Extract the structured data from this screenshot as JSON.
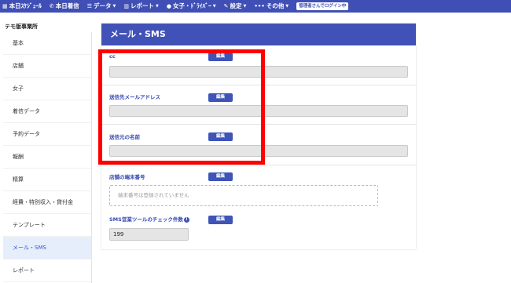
{
  "topnav": {
    "items": [
      {
        "icon": "calendar-icon",
        "glyph": "▦",
        "label": "本日ｽｹｼﾞｭｰﾙ",
        "caret": false
      },
      {
        "icon": "phone-icon",
        "glyph": "✆",
        "label": "本日着信",
        "caret": false
      },
      {
        "icon": "database-icon",
        "glyph": "☰",
        "label": "データ",
        "caret": true
      },
      {
        "icon": "chart-icon",
        "glyph": "▥",
        "label": "レポート",
        "caret": true
      },
      {
        "icon": "user-icon",
        "glyph": "●",
        "label": "女子・ﾄﾞﾗｲﾊﾞｰ",
        "caret": true
      },
      {
        "icon": "wrench-icon",
        "glyph": "✎",
        "label": "設定",
        "caret": true
      },
      {
        "icon": "ellipsis-icon",
        "glyph": "•••",
        "label": "その他",
        "caret": true
      }
    ],
    "login_badge": "管理者さんでログイン中"
  },
  "sidebar": {
    "title": "テモ版事業所",
    "items": [
      {
        "label": "基本",
        "active": false
      },
      {
        "label": "店舗",
        "active": false
      },
      {
        "label": "女子",
        "active": false
      },
      {
        "label": "着信データ",
        "active": false
      },
      {
        "label": "予約データ",
        "active": false
      },
      {
        "label": "報酬",
        "active": false
      },
      {
        "label": "精算",
        "active": false
      },
      {
        "label": "経費・特別収入・貸付金",
        "active": false
      },
      {
        "label": "テンプレート",
        "active": false
      },
      {
        "label": "メール・SMS",
        "active": true
      },
      {
        "label": "レポート",
        "active": false
      }
    ]
  },
  "panel": {
    "title": "メール・SMS",
    "edit_label": "編集",
    "fields": {
      "cc": {
        "label": "cc",
        "value": ""
      },
      "sender_address": {
        "label": "送信先メールアドレス",
        "value": ""
      },
      "sender_name": {
        "label": "送信元の名前",
        "value": ""
      },
      "store_terminal": {
        "label": "店舗の端末番号",
        "empty_text": "端末番号は登録されていません"
      },
      "sms_check": {
        "label": "SMS営業ツールのチェック件数",
        "value": "199"
      }
    }
  },
  "colors": {
    "nav_bg": "#3f4fb5",
    "accent": "#3e55b7",
    "highlight": "#ff0000"
  }
}
